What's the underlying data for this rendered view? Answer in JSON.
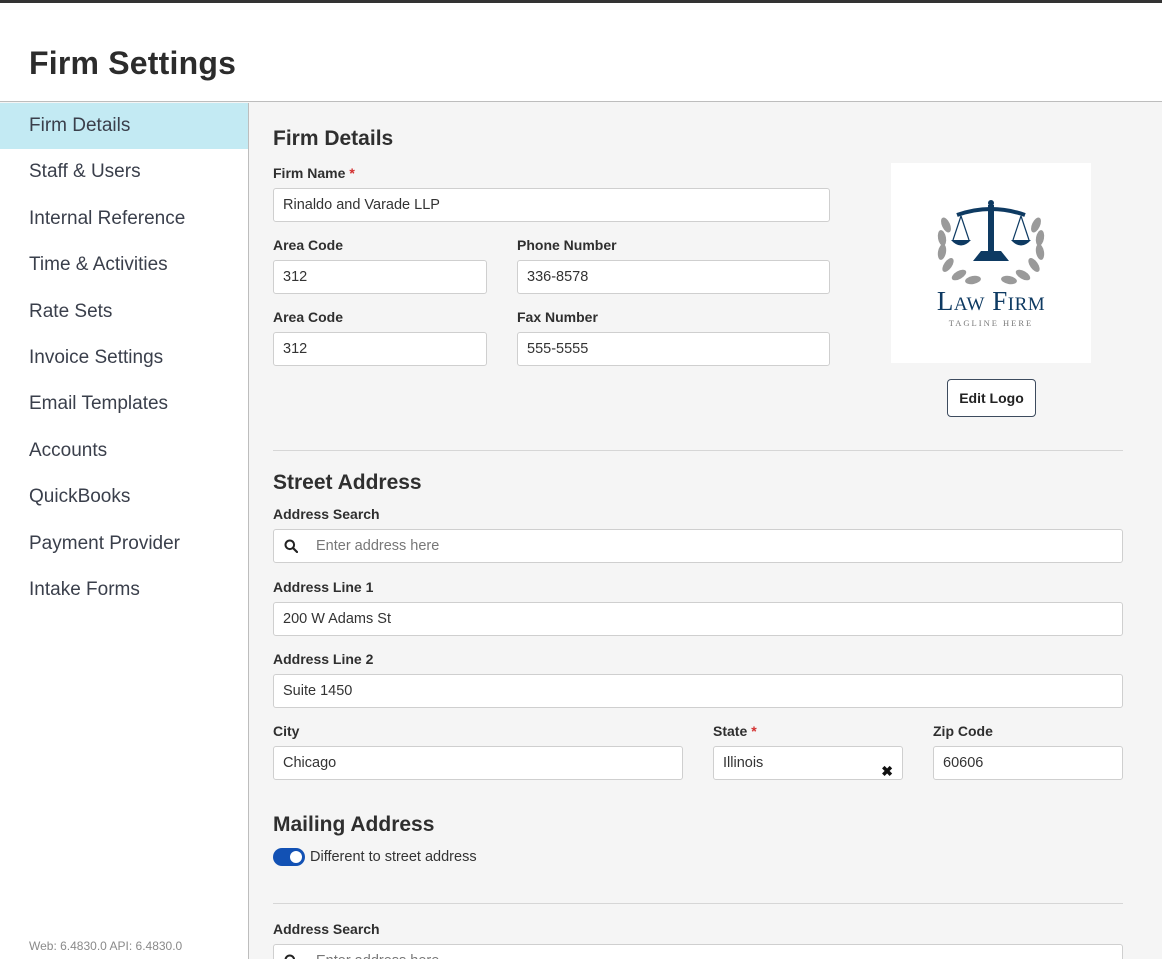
{
  "header": {
    "title": "Firm Settings"
  },
  "sidebar": {
    "items": [
      {
        "label": "Firm Details",
        "active": true
      },
      {
        "label": "Staff & Users"
      },
      {
        "label": "Internal Reference"
      },
      {
        "label": "Time & Activities"
      },
      {
        "label": "Rate Sets"
      },
      {
        "label": "Invoice Settings"
      },
      {
        "label": "Email Templates"
      },
      {
        "label": "Accounts"
      },
      {
        "label": "QuickBooks"
      },
      {
        "label": "Payment Provider"
      },
      {
        "label": "Intake Forms"
      }
    ],
    "version": "Web: 6.4830.0 API: 6.4830.0"
  },
  "firm_details": {
    "title": "Firm Details",
    "firm_name_label": "Firm Name",
    "required_mark": "*",
    "firm_name_value": "Rinaldo and Varade LLP",
    "area_code_label": "Area Code",
    "phone_area_code_value": "312",
    "phone_number_label": "Phone Number",
    "phone_number_value": "336-8578",
    "fax_area_code_label": "Area Code",
    "fax_area_code_value": "312",
    "fax_number_label": "Fax Number",
    "fax_number_value": "555-5555",
    "logo": {
      "title": "Law Firm",
      "tagline": "Tagline Here",
      "color": "#0e3a62"
    },
    "edit_logo_label": "Edit Logo"
  },
  "street_address": {
    "title": "Street Address",
    "search_label": "Address Search",
    "search_placeholder": "Enter address here",
    "line1_label": "Address Line 1",
    "line1_value": "200 W Adams St",
    "line2_label": "Address Line 2",
    "line2_value": "Suite 1450",
    "city_label": "City",
    "city_value": "Chicago",
    "state_label": "State",
    "state_value": "Illinois",
    "clear_icon": "✖",
    "zip_label": "Zip Code",
    "zip_value": "60606"
  },
  "mailing_address": {
    "title": "Mailing Address",
    "toggle_label": "Different to street address",
    "toggle_on": true,
    "toggle_color": "#1251b4",
    "search_label": "Address Search",
    "search_placeholder": "Enter address here"
  },
  "colors": {
    "active_nav": "#c3eaf3",
    "required": "#d32f2f"
  }
}
